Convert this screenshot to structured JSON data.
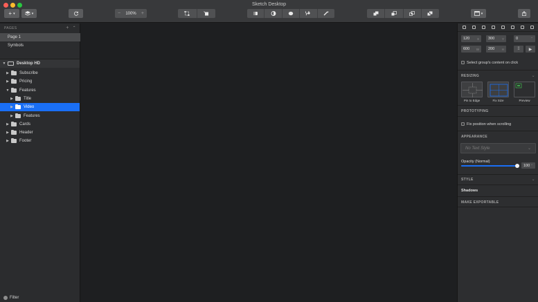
{
  "window": {
    "title": "Sketch Desktop",
    "traffic_colors": [
      "#fd5f57",
      "#febb2d",
      "#29c840"
    ]
  },
  "toolbar": {
    "insert_glyph": "+",
    "create_symbol_icon": "layers-icon",
    "forward_backward_icon": "refresh-icon",
    "zoom": {
      "value": "100%",
      "minus": "−",
      "plus": "+"
    },
    "mirror_icons": [
      "crop-icon",
      "rotate-icon"
    ],
    "edit_icons": [
      "mask-icon",
      "scale-icon",
      "flatten-icon",
      "edit-icon",
      "rotate-copies-icon"
    ],
    "boolean_icons": [
      "union-icon",
      "subtract-icon",
      "intersect-icon",
      "difference-icon"
    ],
    "view_icon": "view-icon",
    "export_icon": "export-icon"
  },
  "sidebar": {
    "pages_header": "PAGES",
    "add_page_glyph": "+",
    "collapse_glyph": "⌃",
    "pages": [
      {
        "label": "Page 1",
        "selected": true
      },
      {
        "label": "Symbols",
        "selected": false
      }
    ],
    "artboard": "Desktop HD",
    "layers": [
      {
        "label": "Subscribe",
        "indent": 1,
        "expanded": false,
        "selected": false
      },
      {
        "label": "Pricing",
        "indent": 1,
        "expanded": false,
        "selected": false
      },
      {
        "label": "Features",
        "indent": 1,
        "expanded": true,
        "selected": false
      },
      {
        "label": "Title",
        "indent": 2,
        "expanded": false,
        "selected": false
      },
      {
        "label": "Video",
        "indent": 2,
        "expanded": false,
        "selected": true
      },
      {
        "label": "Features",
        "indent": 2,
        "expanded": false,
        "selected": false
      },
      {
        "label": "Cards",
        "indent": 1,
        "expanded": false,
        "selected": false
      },
      {
        "label": "Header",
        "indent": 1,
        "expanded": false,
        "selected": false
      },
      {
        "label": "Footer",
        "indent": 1,
        "expanded": false,
        "selected": false
      }
    ],
    "filter_label": "Filter",
    "selection_color": "#1a6ff5"
  },
  "inspector": {
    "position": {
      "x": "120",
      "y": "300",
      "x_sfx": "X",
      "y_sfx": "Y"
    },
    "size": {
      "w": "600",
      "h": "200",
      "w_sfx": "W",
      "h_sfx": "H"
    },
    "rotation": "0",
    "select_group_content": "Select group's content on click",
    "resizing_header": "RESIZING",
    "resize_options": [
      "Pin to Edge",
      "Fix Size",
      "Preview"
    ],
    "prototyping_header": "PROTOTYPING",
    "fix_position": "Fix position when scrolling",
    "appearance_header": "APPEARANCE",
    "text_style_placeholder": "No Text Style",
    "opacity_label": "Opacity (Normal)",
    "opacity_value": "100",
    "opacity_fraction": 1.0,
    "style_header": "STYLE",
    "shadows_label": "Shadows",
    "export_header": "MAKE EXPORTABLE",
    "chevron": "⌄"
  }
}
